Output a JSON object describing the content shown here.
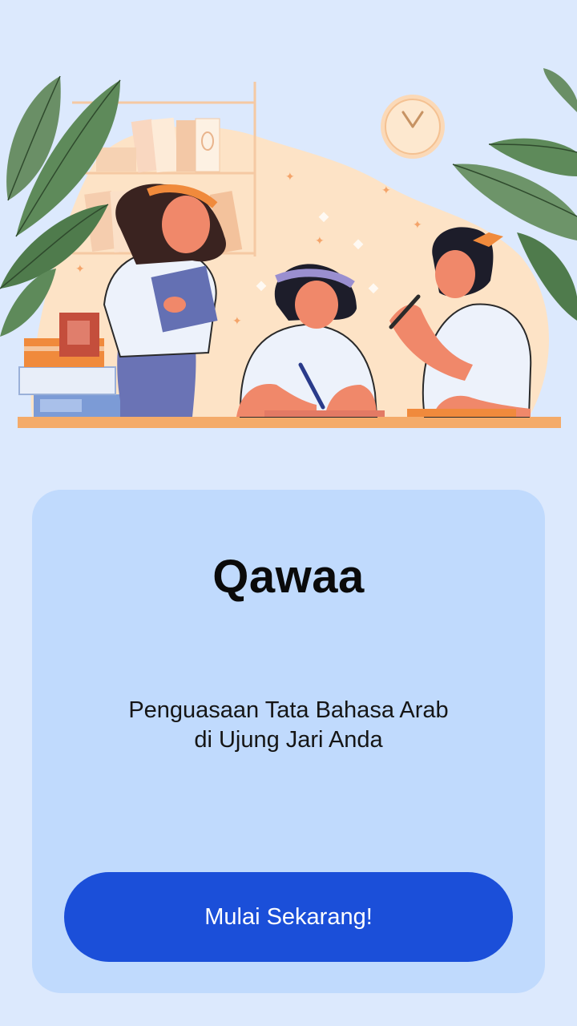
{
  "app": {
    "title": "Qawaa",
    "tagline_line1": "Penguasaan Tata Bahasa Arab",
    "tagline_line2": "di Ujung Jari Anda"
  },
  "actions": {
    "start_label": "Mulai Sekarang!"
  },
  "illustration": {
    "subject": "three students studying at a desk",
    "icons": [
      "wall-clock-icon",
      "bookshelf-icon",
      "plant-leaves-icon",
      "pen-icon",
      "notebook-icon"
    ]
  },
  "colors": {
    "background": "#dce9fd",
    "card": "#c0dafd",
    "button": "#1b4fd9",
    "button_text": "#ffffff",
    "accent_orange": "#f08a3c",
    "skin": "#f0886a",
    "leaf_green": "#5e8a5a",
    "desk": "#f4ab6a"
  }
}
